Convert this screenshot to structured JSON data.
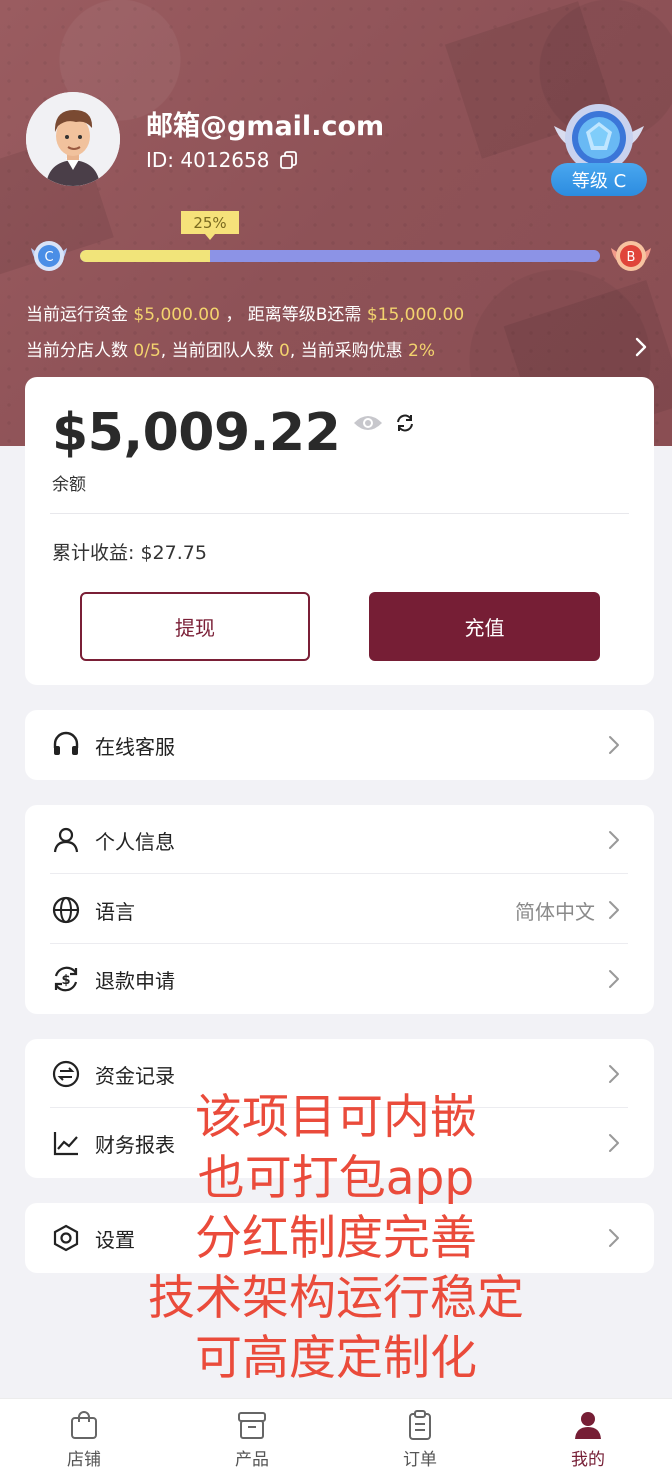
{
  "profile": {
    "email": "邮箱@gmail.com",
    "id_text": "ID: 4012658",
    "level_badge": "等级 C"
  },
  "progress": {
    "tip": "25%",
    "value": 0.25,
    "from_level": "C",
    "to_level": "B"
  },
  "stats": {
    "line1_a": "当前运行资金",
    "line1_funds": "$5,000.00",
    "line1_b": "，  距离等级B还需",
    "line1_need": "$15,000.00",
    "line2_a": "当前分店人数",
    "line2_stores": "0/5",
    "line2_b": ", 当前团队人数",
    "line2_team": "0",
    "line2_c": ", 当前采购优惠",
    "line2_discount": "2%"
  },
  "balance": {
    "amount": "$5,009.22",
    "label": "余额",
    "earnings": "累计收益: $27.75",
    "withdraw_label": "提现",
    "recharge_label": "充值"
  },
  "menu": {
    "service": "在线客服",
    "personal_info": "个人信息",
    "language": "语言",
    "language_value": "简体中文",
    "refund": "退款申请",
    "fund_records": "资金记录",
    "financial_report": "财务报表",
    "settings": "设置"
  },
  "overlay_text": [
    "该项目可内嵌",
    "也可打包app",
    "分红制度完善",
    "技术架构运行稳定",
    "可高度定制化"
  ],
  "tabs": [
    {
      "label": "店铺",
      "icon": "shop-bag-icon"
    },
    {
      "label": "产品",
      "icon": "archive-box-icon"
    },
    {
      "label": "订单",
      "icon": "clipboard-icon"
    },
    {
      "label": "我的",
      "icon": "user-icon"
    }
  ],
  "colors": {
    "hero": "#8e5257",
    "accent": "#761e35",
    "gold": "#f3d36e",
    "overlay": "#ea4b3b"
  }
}
